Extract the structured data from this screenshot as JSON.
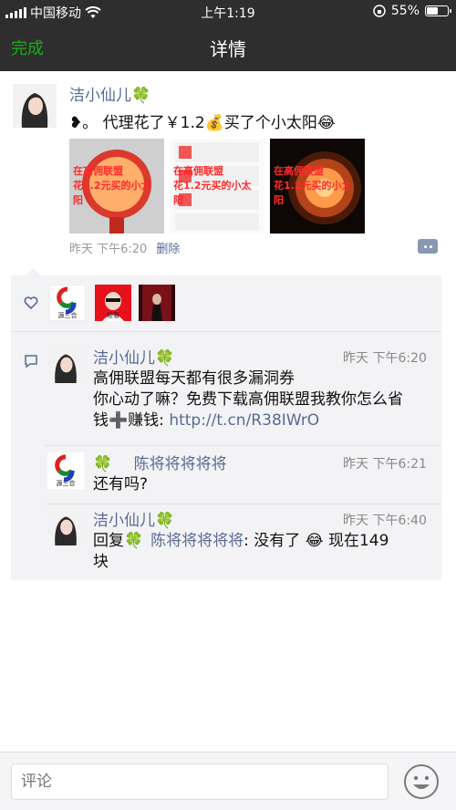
{
  "status_bar": {
    "carrier": "中国移动",
    "time": "上午1:19",
    "battery_text": "55%",
    "battery_level": 0.55
  },
  "nav": {
    "done_label": "完成",
    "title": "详情"
  },
  "post": {
    "author": "洁小仙儿🍀",
    "text": "❥。    代理花了￥1.2💰买了个小太阳😂",
    "images": [
      {
        "caption": "在高佣联盟\n花1.2元买的小太阳"
      },
      {
        "caption": "在高佣联盟\n花1.2元买的小太阳"
      },
      {
        "caption": "在高佣联盟\n花1.2元买的小太阳"
      }
    ],
    "time": "昨天 下午6:20",
    "delete_label": "删除"
  },
  "likes": {
    "avatars": [
      {
        "label": "源三合"
      },
      {
        "label": "轻奢"
      },
      {
        "label": ""
      }
    ]
  },
  "comments": [
    {
      "author": "洁小仙儿🍀",
      "time": "昨天 下午6:20",
      "line1": "高佣联盟每天都有很多漏洞券",
      "line2": "你心动了嘛？免费下载高佣联盟我教你怎么省",
      "line3_prefix": "钱➕赚钱: ",
      "link": "http://t.cn/R38IWrO"
    },
    {
      "author": "🍀",
      "author_name": "陈将将将将将",
      "avatar_label": "源三合",
      "time": "昨天 下午6:21",
      "text": "还有吗?"
    },
    {
      "author": "洁小仙儿🍀",
      "time": "昨天 下午6:40",
      "reply_prefix": "回复🍀",
      "reply_to": "陈将将将将将",
      "text_line1": ": 没有了 😂 现在149",
      "text_line2": "块"
    }
  ],
  "input": {
    "placeholder": "评论"
  }
}
